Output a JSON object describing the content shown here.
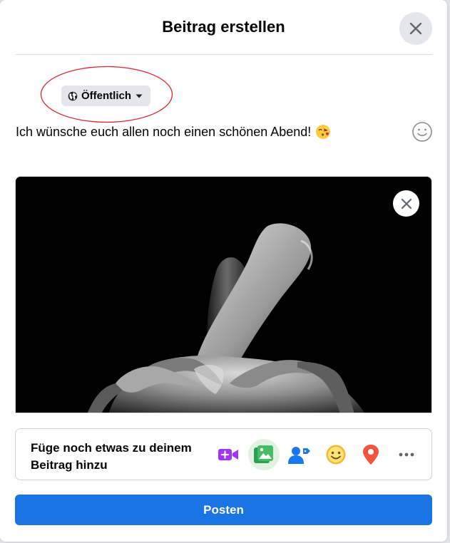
{
  "dialog": {
    "title": "Beitrag erstellen",
    "close_icon": "close-icon"
  },
  "privacy": {
    "label": "Öffentlich",
    "icon": "globe-icon",
    "dropdown_icon": "caret-down-icon",
    "annotation_color": "#e0242b"
  },
  "post": {
    "text": "Ich wünsche euch allen noch einen schönen Abend!",
    "emoji": "😘",
    "emoji_picker_icon": "smiley-outline-icon"
  },
  "media": {
    "remove_icon": "close-icon"
  },
  "add_to_post": {
    "label": "Füge noch etwas zu deinem Beitrag hinzu",
    "icons": [
      {
        "name": "live-video-icon",
        "color": "#a033ff"
      },
      {
        "name": "photo-video-icon",
        "color": "#45bd62"
      },
      {
        "name": "tag-people-icon",
        "color": "#1877f2"
      },
      {
        "name": "feeling-activity-icon",
        "color": "#f7b928"
      },
      {
        "name": "check-in-icon",
        "color": "#f5533d"
      },
      {
        "name": "more-icon",
        "color": "#65676b"
      }
    ]
  },
  "submit": {
    "label": "Posten",
    "color": "#1b74e4"
  }
}
